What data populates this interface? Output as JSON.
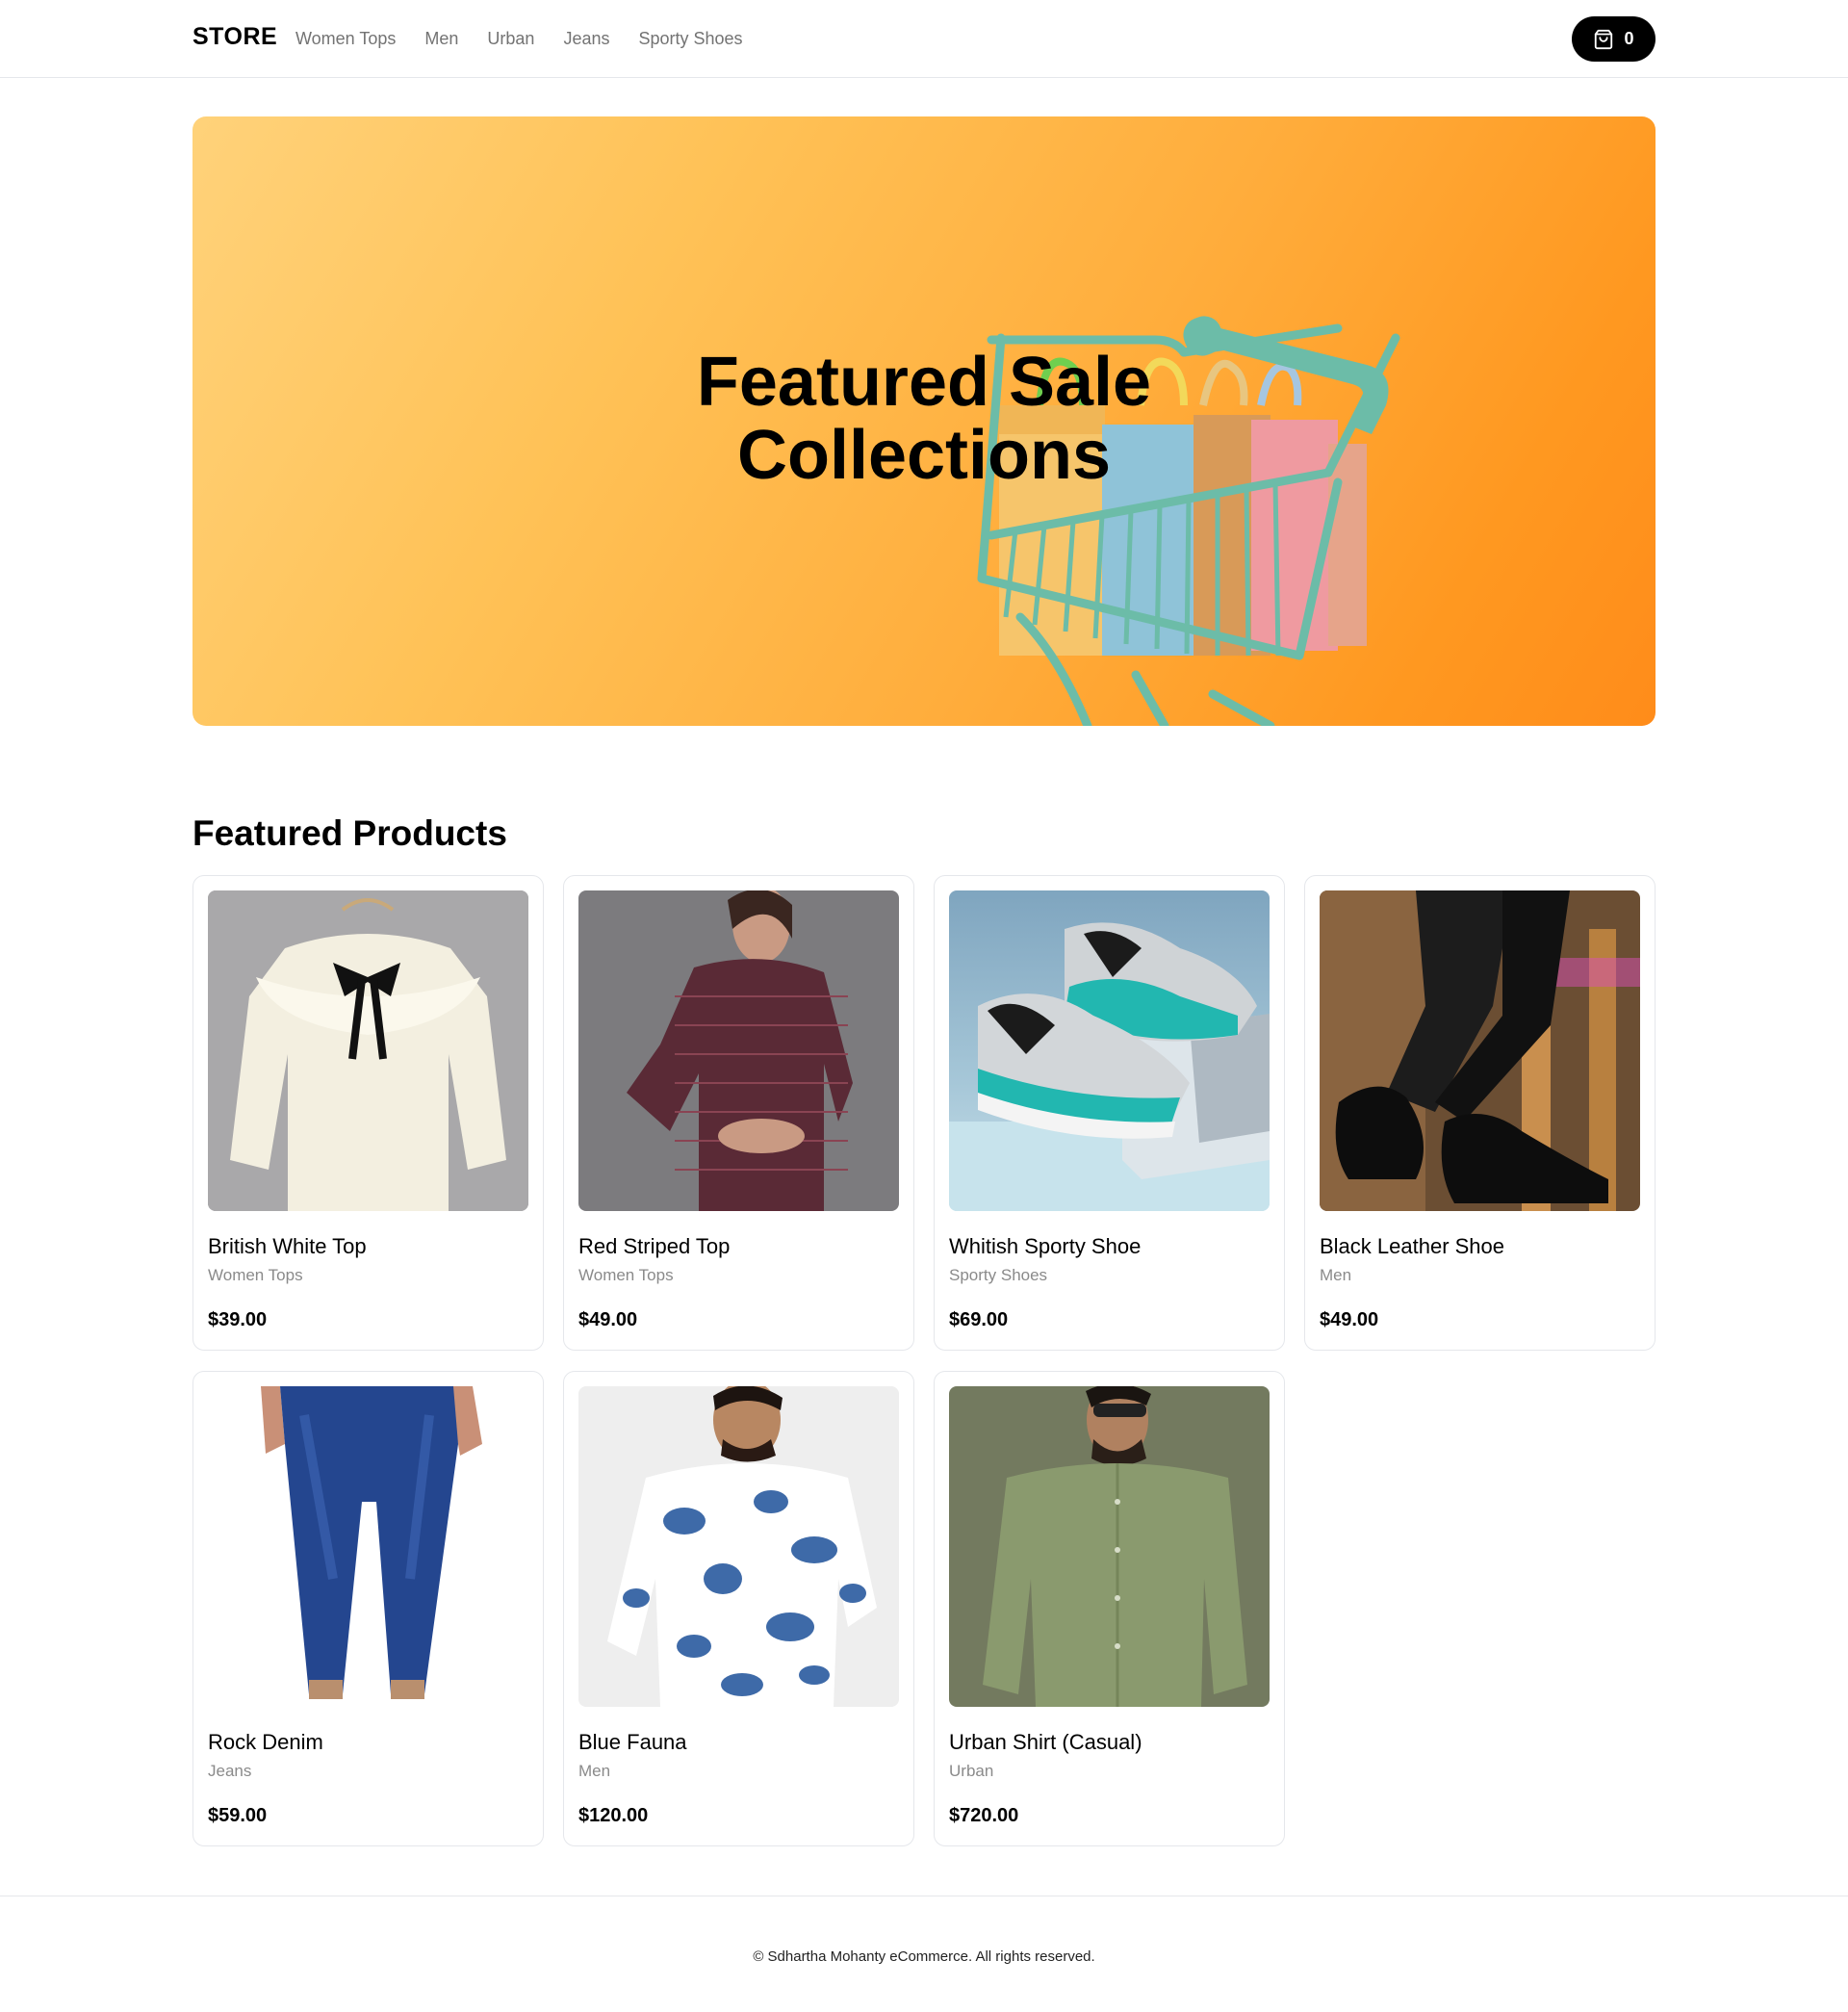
{
  "nav": {
    "brand": "STORE",
    "links": [
      "Women Tops",
      "Men",
      "Urban",
      "Jeans",
      "Sporty Shoes"
    ],
    "cart_count": "0"
  },
  "hero": {
    "title_line1": "Featured Sale",
    "title_line2": "Collections",
    "gradient_start": "#ffd27a",
    "gradient_end": "#ff8c1a",
    "cart_color": "#6cbca8"
  },
  "featured": {
    "title": "Featured Products",
    "products": [
      {
        "name": "British White Top",
        "category": "Women Tops",
        "price": "$39.00"
      },
      {
        "name": "Red Striped Top",
        "category": "Women Tops",
        "price": "$49.00"
      },
      {
        "name": "Whitish Sporty Shoe",
        "category": "Sporty Shoes",
        "price": "$69.00"
      },
      {
        "name": "Black Leather Shoe",
        "category": "Men",
        "price": "$49.00"
      },
      {
        "name": "Rock Denim",
        "category": "Jeans",
        "price": "$59.00"
      },
      {
        "name": "Blue Fauna",
        "category": "Men",
        "price": "$120.00"
      },
      {
        "name": "Urban Shirt (Casual)",
        "category": "Urban",
        "price": "$720.00"
      }
    ]
  },
  "footer": {
    "text": "© Sdhartha Mohanty eCommerce. All rights reserved."
  }
}
